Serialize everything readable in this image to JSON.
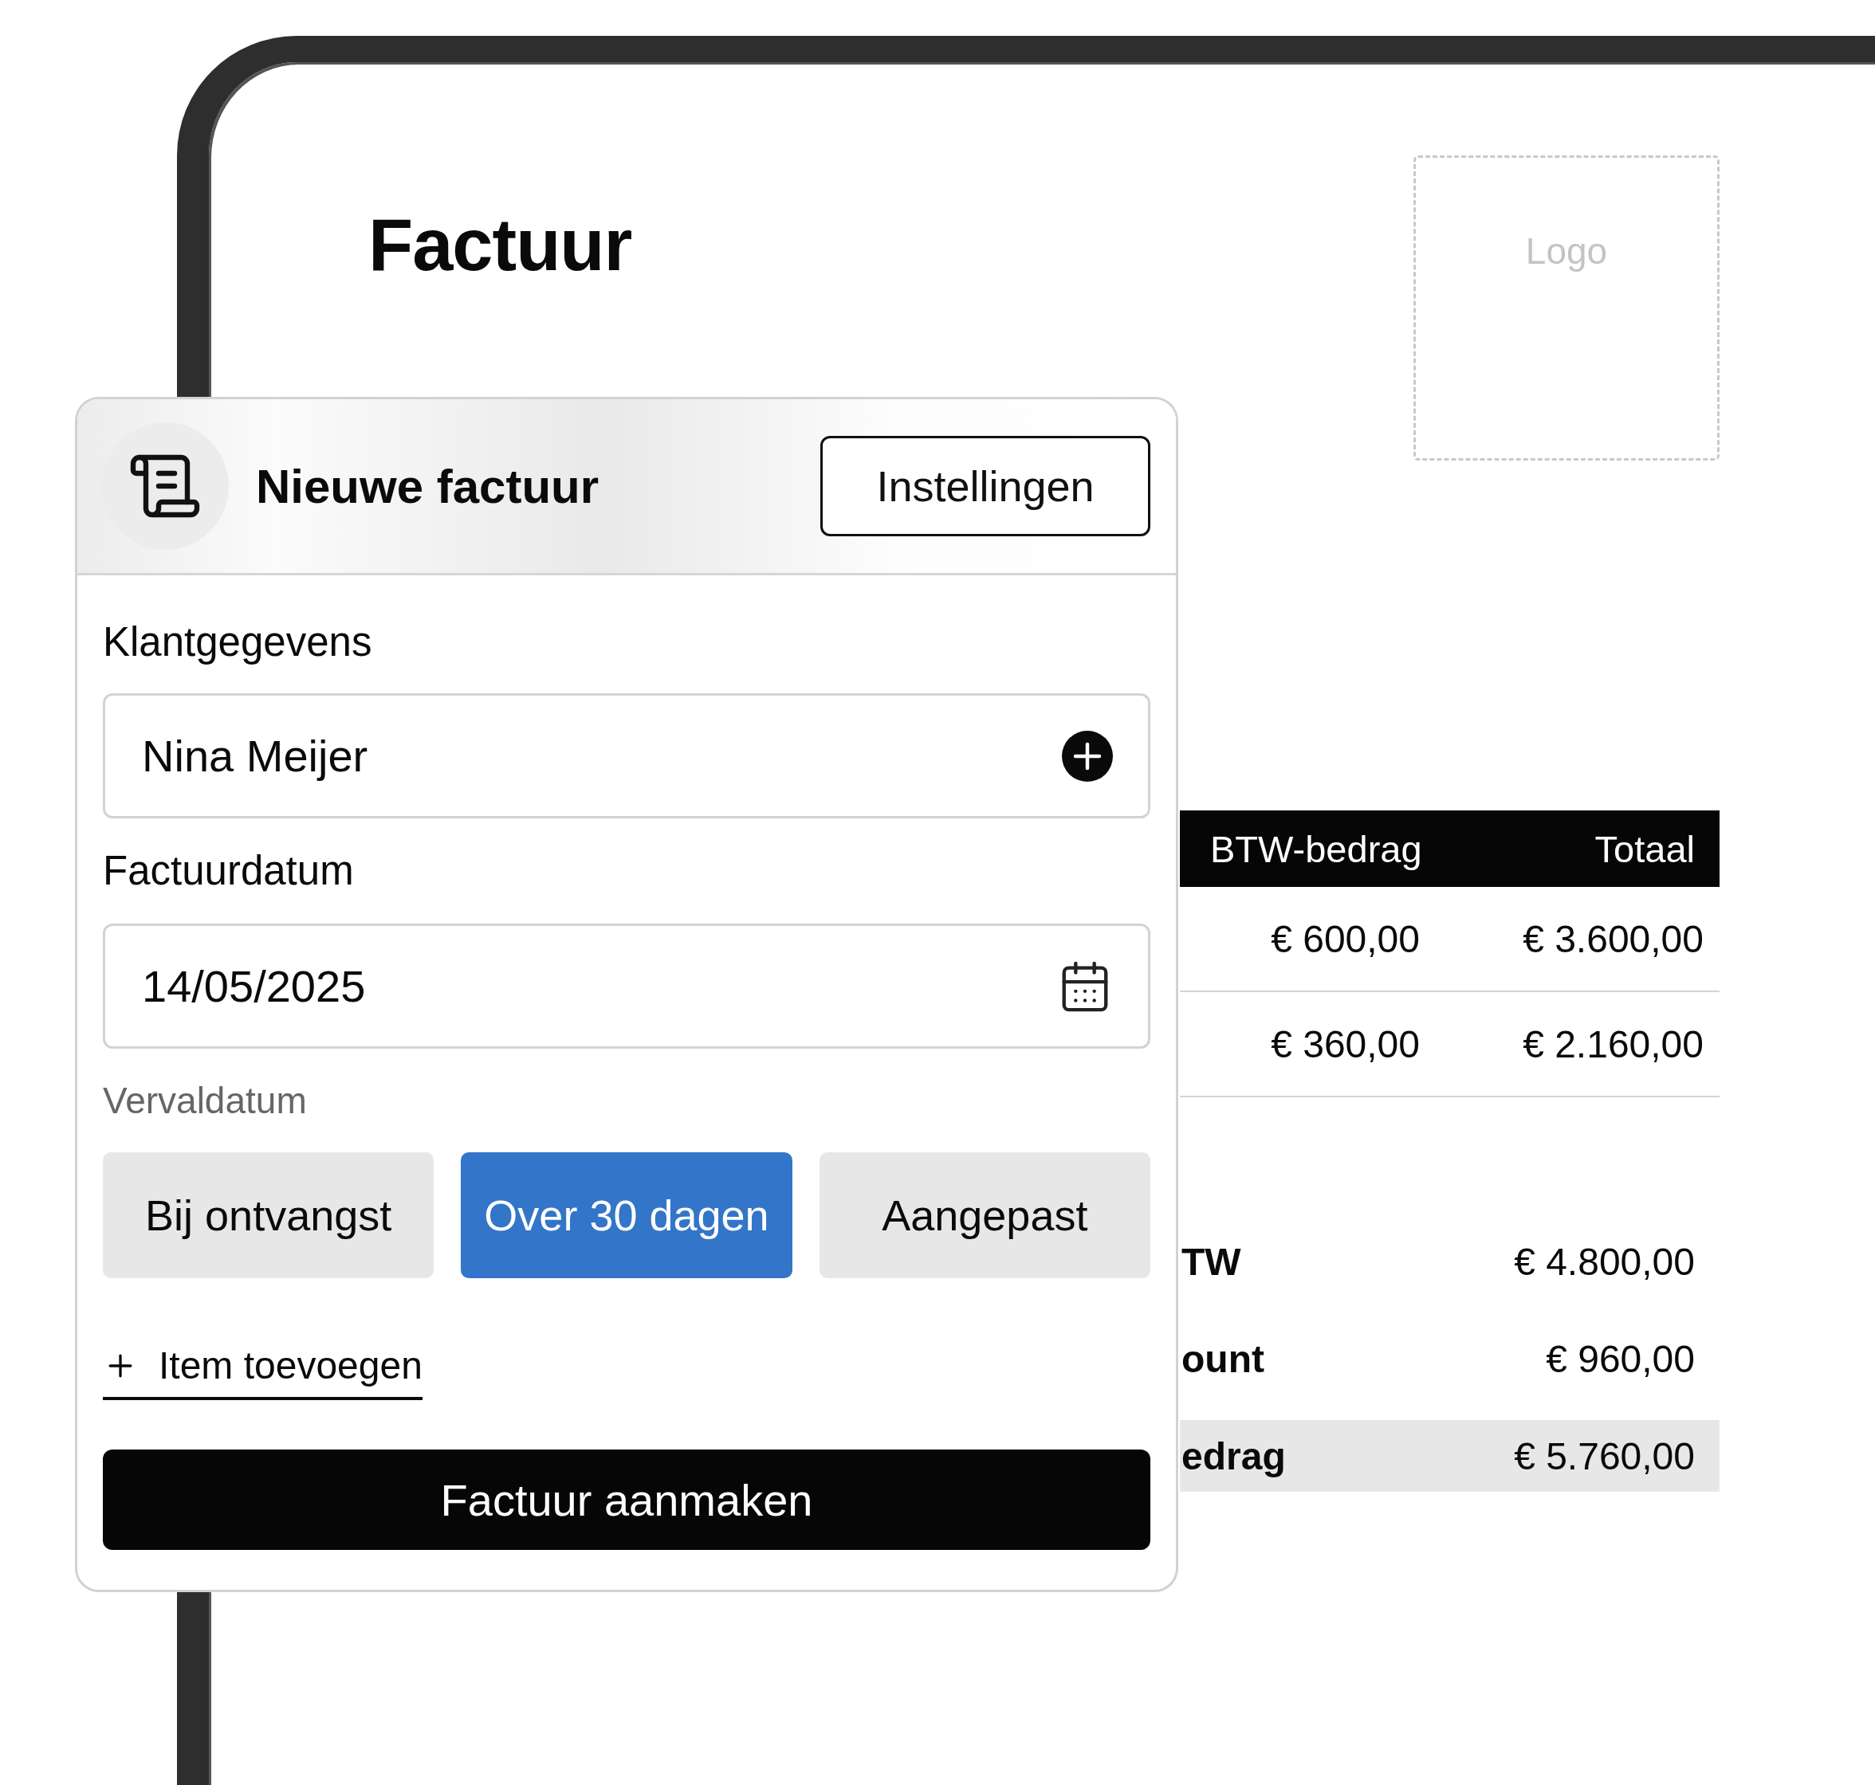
{
  "document": {
    "title": "Factuur",
    "logo_placeholder": "Logo"
  },
  "table": {
    "columns": [
      "BTW-bedrag",
      "Totaal"
    ],
    "rows": [
      [
        "€ 600,00",
        "€ 3.600,00"
      ],
      [
        "€ 360,00",
        "€ 2.160,00"
      ]
    ]
  },
  "totals": [
    {
      "label": "TW",
      "value": "€ 4.800,00",
      "highlighted": false
    },
    {
      "label": "ount",
      "value": "€ 960,00",
      "highlighted": false
    },
    {
      "label": "edrag",
      "value": "€ 5.760,00",
      "highlighted": true
    }
  ],
  "panel": {
    "title": "Nieuwe factuur",
    "settings_button": "Instellingen",
    "customer_label": "Klantgegevens",
    "customer_value": "Nina Meijer",
    "date_label": "Factuurdatum",
    "date_value": "14/05/2025",
    "due_label": "Vervaldatum",
    "due_options": [
      {
        "label": "Bij ontvangst",
        "selected": false
      },
      {
        "label": "Over 30 dagen",
        "selected": true
      },
      {
        "label": "Aangepast",
        "selected": false
      }
    ],
    "add_item": "Item toevoegen",
    "create_button": "Factuur aanmaken"
  }
}
